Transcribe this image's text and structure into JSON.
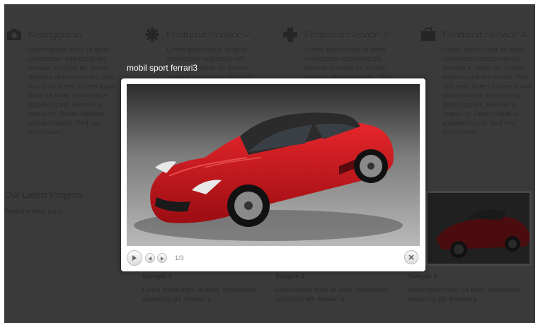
{
  "services": [
    {
      "title": "Keunggulan",
      "icon": "camera-icon",
      "text": "Lorem ipsum dolor sit amet, consectetur adipiscing elit. Aenean a neque mi. Donec dapibus aliquam iaculis. Sed non enim lorem. Lorem ipsum dolor sit amet, consectetur adipiscing elit. Aenean a neque mi. Donec dapibus aliquam iaculis. Sed non enim lorem."
    },
    {
      "title": "Featured Service 2",
      "icon": "gear-icon",
      "text": "Lorem ipsum dolor sit amet, consectetur adipiscing elit. Aenean a neque mi. Donec dapibus aliquam iaculis. Sed non enim lorem. Lorem ipsum dolor sit amet, consectetur adipiscing elit. Aenean a neque mi. Donec dapibus aliquam iaculis. Sed non enim lorem."
    },
    {
      "title": "Featured Service 3",
      "icon": "plus-icon",
      "text": "Lorem ipsum dolor sit amet, consectetur adipiscing elit. Aenean a neque mi. Donec dapibus aliquam iaculis. Sed non enim lorem. Lorem ipsum dolor sit amet, consectetur adipiscing elit. Aenean a neque mi. Donec dapibus aliquam iaculis. Sed non enim lorem."
    },
    {
      "title": "Featured Service 4",
      "icon": "briefcase-icon",
      "text": "Lorem ipsum dolor sit amet, consectetur adipiscing elit. Aenean a neque mi. Donec dapibus aliquam iaculis. Sed non enim lorem. Lorem ipsum dolor sit amet, consectetur adipiscing elit. Aenean a neque mi. Donec dapibus aliquam iaculis. Sed non enim lorem."
    }
  ],
  "latest": {
    "title": "Our Latest Projects",
    "subtitle": "Produk terbaru kami"
  },
  "samples": [
    {
      "title": "Sample 1",
      "text": "Lorem ipsum dolor sit amet, consectetur adipiscing elit. Aenean a"
    },
    {
      "title": "Sample 2",
      "text": "Lorem ipsum dolor sit amet, consectetur adipiscing elit. Aenean a"
    },
    {
      "title": "Sample 1",
      "text": "Lorem ipsum dolor sit amet, consectetur adipiscing elit. Aenean a"
    }
  ],
  "lightbox": {
    "title": "mobil sport ferrari3",
    "counter": "1/3",
    "play_icon": "play-icon",
    "prev_icon": "previous-icon",
    "next_icon": "next-icon",
    "close_icon": "close-icon"
  },
  "colors": {
    "overlay": "#3a3a3a",
    "car_red": "#c8141a"
  }
}
